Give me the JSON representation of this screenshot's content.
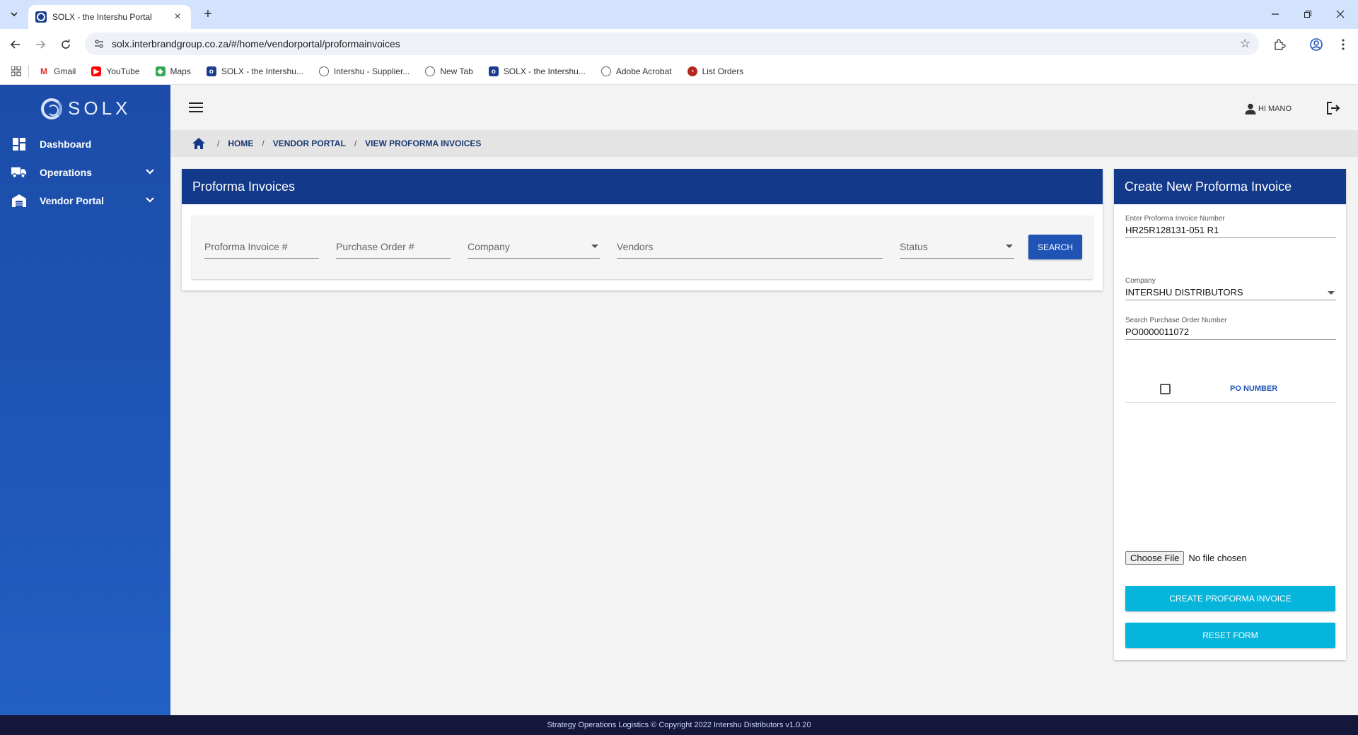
{
  "browser": {
    "tab_title": "SOLX - the Intershu Portal",
    "url": "solx.interbrandgroup.co.za/#/home/vendorportal/proformainvoices",
    "bookmarks": [
      {
        "label": "Gmail",
        "icon": "gmail-icon",
        "color": "#d93025"
      },
      {
        "label": "YouTube",
        "icon": "youtube-icon",
        "color": "#ff0000"
      },
      {
        "label": "Maps",
        "icon": "maps-icon",
        "color": "#34a853"
      },
      {
        "label": "SOLX - the Intershu...",
        "icon": "solx-icon",
        "color": "#1a3d8f"
      },
      {
        "label": "Intershu - Supplier...",
        "icon": "globe-icon",
        "color": "#5f6368"
      },
      {
        "label": "New Tab",
        "icon": "globe-icon",
        "color": "#5f6368"
      },
      {
        "label": "SOLX - the Intershu...",
        "icon": "solx-icon",
        "color": "#1a3d8f"
      },
      {
        "label": "Adobe Acrobat",
        "icon": "globe-icon",
        "color": "#5f6368"
      },
      {
        "label": "List Orders",
        "icon": "list-orders-icon",
        "color": "#b3261e"
      }
    ]
  },
  "app": {
    "logo": "SOLX",
    "user_greeting": "HI MANO",
    "accent_color": "#12398a",
    "sidebar": [
      {
        "label": "Dashboard",
        "icon": "dashboard-icon",
        "expandable": false
      },
      {
        "label": "Operations",
        "icon": "truck-icon",
        "expandable": true
      },
      {
        "label": "Vendor Portal",
        "icon": "warehouse-icon",
        "expandable": true
      }
    ],
    "breadcrumb": [
      "HOME",
      "VENDOR PORTAL",
      "VIEW PROFORMA INVOICES"
    ]
  },
  "invoices_panel": {
    "title": "Proforma Invoices",
    "filters": {
      "proforma_invoice": "Proforma Invoice #",
      "purchase_order": "Purchase Order #",
      "company": "Company",
      "vendors": "Vendors",
      "status": "Status"
    },
    "search_label": "SEARCH"
  },
  "create_panel": {
    "title": "Create New Proforma Invoice",
    "invoice_number_label": "Enter Proforma Invoice Number",
    "invoice_number_value": "HR25R128131-051 R1",
    "company_label": "Company",
    "company_value": "INTERSHU DISTRIBUTORS",
    "po_search_label": "Search Purchase Order Number",
    "po_search_value": "PO0000011072",
    "po_column_label": "PO NUMBER",
    "choose_file_label": "Choose File",
    "file_status": "No file chosen",
    "create_label": "CREATE PROFORMA INVOICE",
    "reset_label": "RESET FORM"
  },
  "footer": "Strategy Operations Logistics © Copyright 2022 Intershu Distributors v1.0.20"
}
